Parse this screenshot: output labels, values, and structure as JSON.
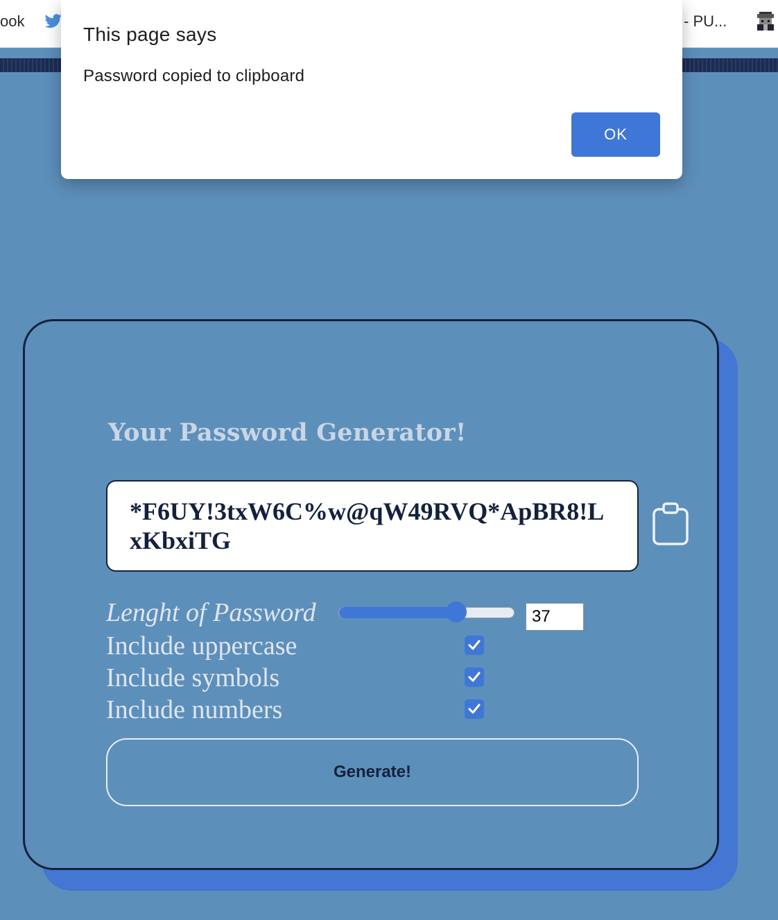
{
  "browser": {
    "bookmark_left": "ook",
    "bookmark_right": "- PU..."
  },
  "alert": {
    "title": "This page says",
    "message": "Password copied to clipboard",
    "ok_label": "OK"
  },
  "generator": {
    "title": "Your Password Generator!",
    "password": "*F6UY!3txW6C%w@qW49RVQ*ApBR8!LxKbxiTG",
    "clipboard_icon": "clipboard-icon",
    "length_label": "Lenght of Password",
    "length_value": "37",
    "length_fraction": 0.67,
    "options": {
      "uppercase_label": "Include uppercase",
      "uppercase_checked": true,
      "symbols_label": "Include symbols",
      "symbols_checked": true,
      "numbers_label": "Include numbers",
      "numbers_checked": true
    },
    "generate_label": "Generate!"
  },
  "colors": {
    "page_background": "#5d8fbb",
    "accent": "#3f77d6",
    "card_border": "#14213d",
    "card_shadow": "#4377d3",
    "title_text": "#c9d6e4"
  }
}
